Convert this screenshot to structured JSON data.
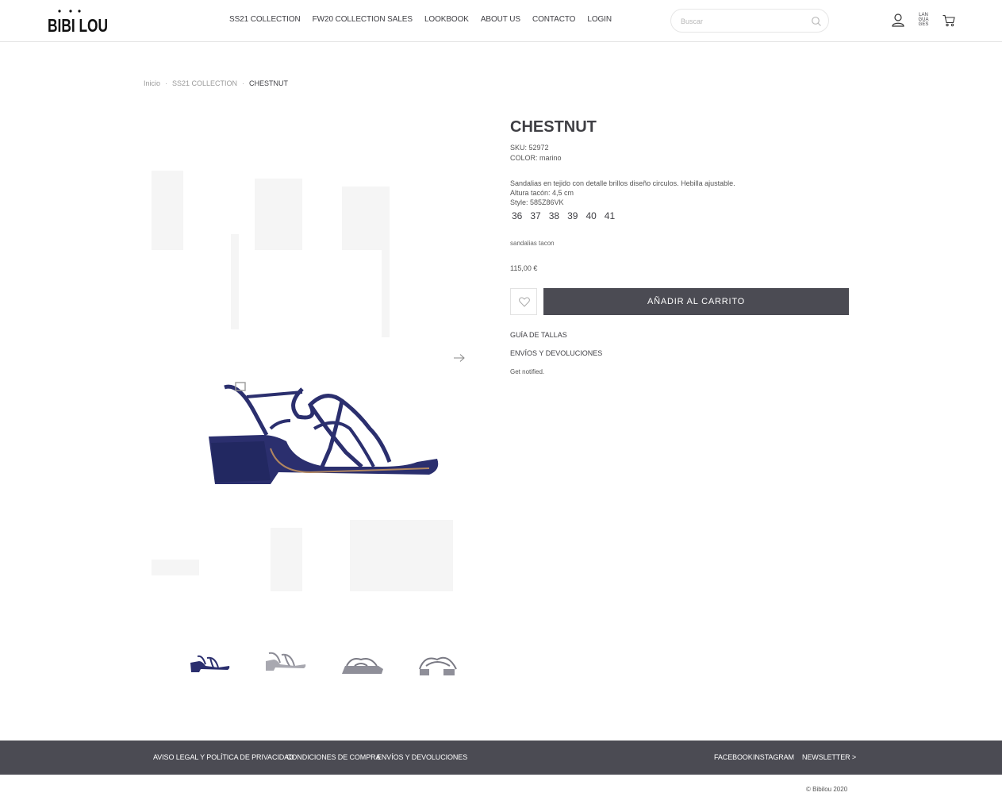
{
  "brand": {
    "logo_text": "BIBI LOU"
  },
  "nav": {
    "items": [
      {
        "label": "SS21 COLLECTION"
      },
      {
        "label": "FW20 COLLECTION SALES"
      },
      {
        "label": "LOOKBOOK"
      },
      {
        "label": "ABOUT US"
      },
      {
        "label": "CONTACTO"
      },
      {
        "label": "LOGIN"
      }
    ]
  },
  "search": {
    "placeholder": "Buscar"
  },
  "header": {
    "languages_label_1": "LAN",
    "languages_label_2": "GUA",
    "languages_label_3": "GES"
  },
  "breadcrumb": {
    "home": "Inicio",
    "sep": "·",
    "collection": "SS21 COLLECTION",
    "current": "CHESTNUT"
  },
  "product": {
    "title": "CHESTNUT",
    "sku": "SKU: 52972",
    "color": "COLOR: marino",
    "desc_line1": "Sandalias en tejido con detalle brillos diseño circulos. Hebilla ajustable.",
    "desc_line2": "Altura tacón: 4,5 cm",
    "desc_line3": "Style: 585Z86VK",
    "sizes": [
      "36",
      "37",
      "38",
      "39",
      "40",
      "41"
    ],
    "tag": "sandalias tacon",
    "price": "115,00 €",
    "add_to_cart": "AÑADIR AL CARRITO",
    "size_guide": "GUÍA DE TALLAS",
    "shipping": "ENVÍOS Y DEVOLUCIONES",
    "notify": "Get notified."
  },
  "footer": {
    "legal": "AVISO LEGAL Y POLÍTICA DE PRIVACIDAD",
    "terms": "CONDICIONES DE COMPRA",
    "shipping": "ENVÍOS Y DEVOLUCIONES",
    "facebook": "FACEBOOK",
    "instagram": "INSTAGRAM",
    "newsletter": "NEWSLETTER >",
    "copyright": "© Bibilou 2020"
  },
  "colors": {
    "accent": "#4b4b53",
    "shoe": "#2b2f6e"
  },
  "icons": [
    "search-icon",
    "user-icon",
    "cart-icon",
    "heart-icon",
    "arrow-right-icon"
  ]
}
